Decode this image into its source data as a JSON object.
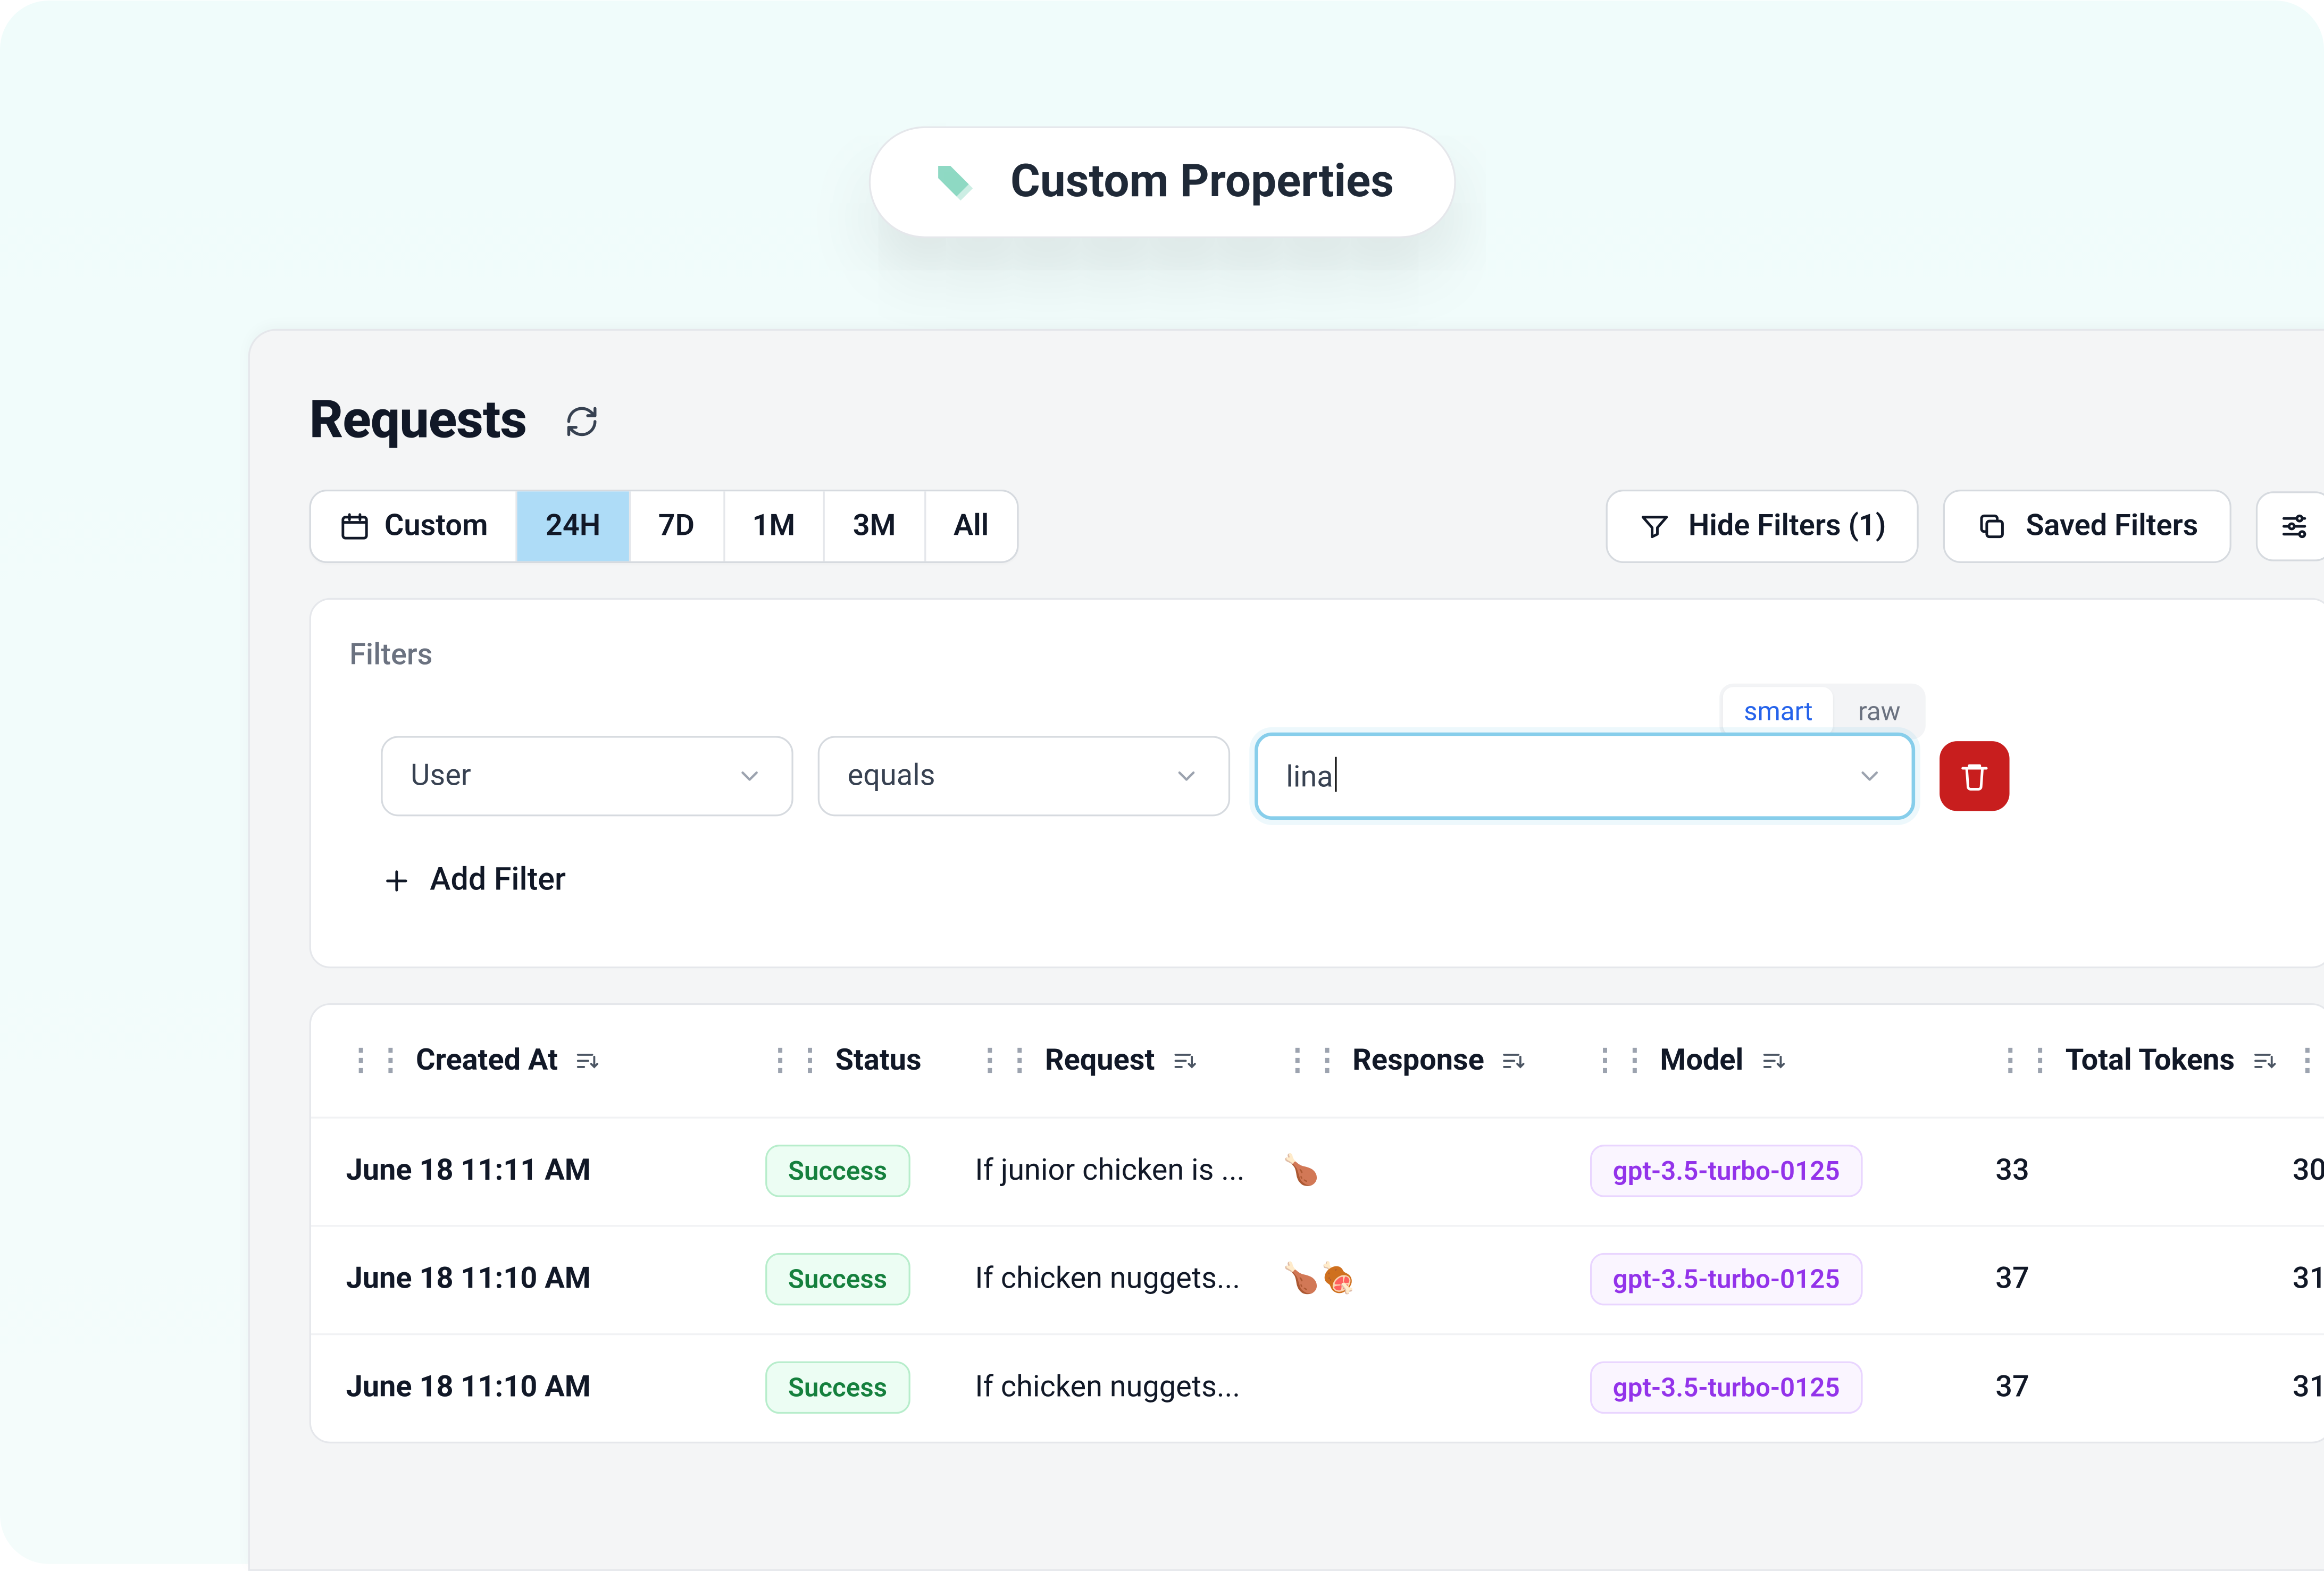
{
  "pill": {
    "label": "Custom Properties"
  },
  "header": {
    "title": "Requests"
  },
  "time_range": {
    "custom": "Custom",
    "items": [
      "24H",
      "7D",
      "1M",
      "3M",
      "All"
    ],
    "active_index": 0
  },
  "toolbar": {
    "hide_filters": "Hide Filters (1)",
    "saved_filters": "Saved Filters"
  },
  "filters": {
    "title": "Filters",
    "mode_smart": "smart",
    "mode_raw": "raw",
    "row": {
      "field": "User",
      "operator": "equals",
      "value": "lina"
    },
    "add_filter": "Add Filter"
  },
  "table": {
    "columns": {
      "created_at": "Created At",
      "status": "Status",
      "request": "Request",
      "response": "Response",
      "model": "Model",
      "total_tokens": "Total Tokens"
    },
    "rows": [
      {
        "created": "June 18 11:11 AM",
        "status": "Success",
        "request": "If junior chicken is ...",
        "response": "🍗",
        "model": "gpt-3.5-turbo-0125",
        "tokens": "33",
        "extra": "30"
      },
      {
        "created": "June 18 11:10 AM",
        "status": "Success",
        "request": "If chicken nuggets...",
        "response": "🍗🍖",
        "model": "gpt-3.5-turbo-0125",
        "tokens": "37",
        "extra": "31"
      },
      {
        "created": "June 18 11:10 AM",
        "status": "Success",
        "request": "If chicken nuggets...",
        "response": "",
        "model": "gpt-3.5-turbo-0125",
        "tokens": "37",
        "extra": "31"
      }
    ]
  }
}
